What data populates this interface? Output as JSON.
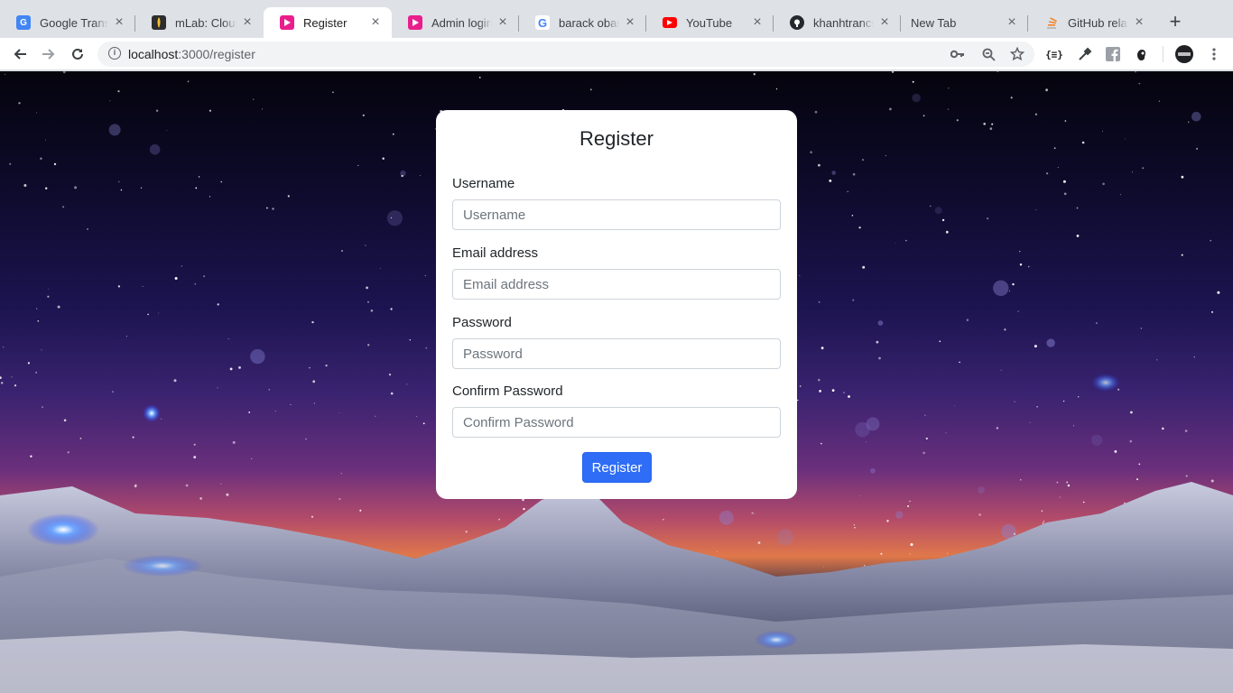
{
  "browser": {
    "tabs": [
      {
        "title": "Google Transl",
        "favicon": "google-translate-icon",
        "color": "#4285f4"
      },
      {
        "title": "mLab: Cloud-",
        "favicon": "mlab-icon",
        "color": "#2d2d2d"
      },
      {
        "title": "Register",
        "favicon": "app-play-icon",
        "color": "#e91e8c",
        "active": true
      },
      {
        "title": "Admin login",
        "favicon": "app-play-icon",
        "color": "#e91e8c"
      },
      {
        "title": "barack obam",
        "favicon": "google-icon",
        "color": "#4285f4"
      },
      {
        "title": "YouTube",
        "favicon": "youtube-icon",
        "color": "#ff0000"
      },
      {
        "title": "khanhtrancse",
        "favicon": "github-icon",
        "color": "#24292e"
      },
      {
        "title": "New Tab",
        "favicon": "",
        "color": ""
      },
      {
        "title": "GitHub relativ",
        "favicon": "stackoverflow-icon",
        "color": "#f48024"
      }
    ],
    "url_host": "localhost",
    "url_path": ":3000/register"
  },
  "form": {
    "title": "Register",
    "username_label": "Username",
    "username_placeholder": "Username",
    "email_label": "Email address",
    "email_placeholder": "Email address",
    "password_label": "Password",
    "password_placeholder": "Password",
    "confirm_label": "Confirm Password",
    "confirm_placeholder": "Confirm Password",
    "submit_label": "Register"
  },
  "colors": {
    "accent": "#2f6df6"
  }
}
